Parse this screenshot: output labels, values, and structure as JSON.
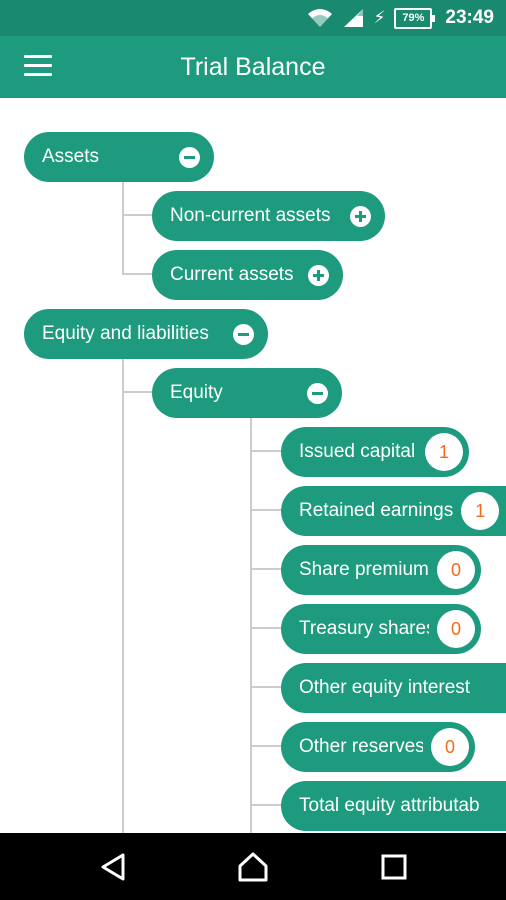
{
  "status_bar": {
    "battery_percent": "79%",
    "time": "23:49",
    "icons": [
      "wifi-icon",
      "cell-signal-icon",
      "charging-bolt-icon",
      "battery-icon"
    ]
  },
  "app_bar": {
    "title": "Trial Balance",
    "menu_icon": "hamburger-menu-icon"
  },
  "tree": {
    "assets": {
      "label": "Assets",
      "expanded": true
    },
    "non_current_assets": {
      "label": "Non-current assets",
      "expanded": false
    },
    "current_assets": {
      "label": "Current assets",
      "expanded": false
    },
    "equity_and_liabilities": {
      "label": "Equity and liabilities",
      "expanded": true
    },
    "equity": {
      "label": "Equity",
      "expanded": true
    },
    "equity_items": [
      {
        "label": "Issued capital",
        "count": "1"
      },
      {
        "label": "Retained earnings",
        "count": "1"
      },
      {
        "label": "Share premium",
        "count": "0"
      },
      {
        "label": "Treasury shares",
        "count": "0"
      },
      {
        "label": "Other equity interest",
        "count": ""
      },
      {
        "label": "Other reserves",
        "count": "0"
      },
      {
        "label": "Total equity attributab",
        "count": ""
      }
    ]
  },
  "colors": {
    "status_bar": "#19896f",
    "primary": "#1e9b7e",
    "count_text": "#f26a1b",
    "connector": "#cccccc"
  },
  "nav_bar": {
    "icons": [
      "back-triangle-icon",
      "home-icon",
      "recents-square-icon"
    ]
  }
}
